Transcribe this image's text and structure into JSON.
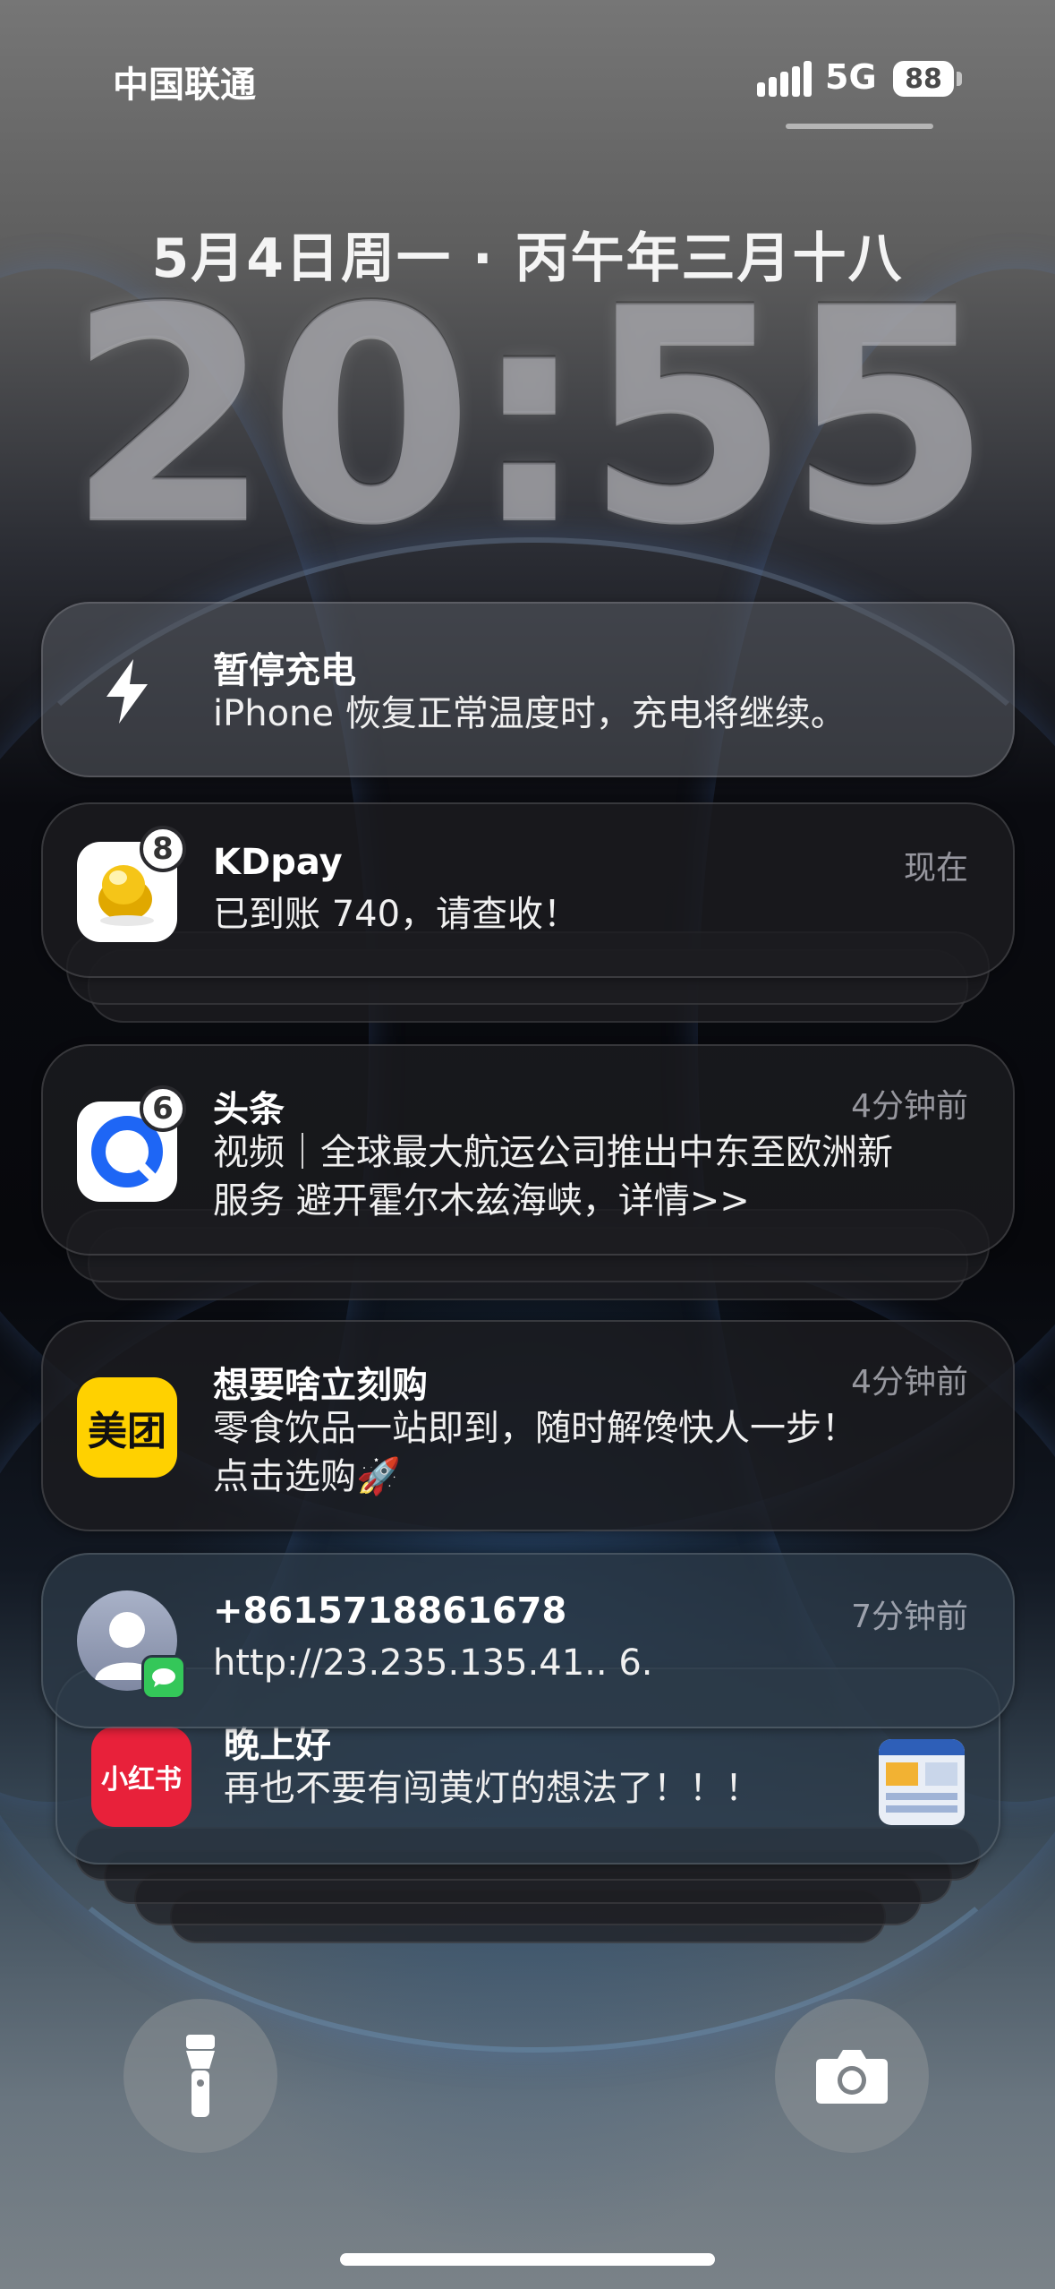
{
  "status_bar": {
    "carrier": "中国联通",
    "network": "5G",
    "battery": "88"
  },
  "lock_screen": {
    "date": "5月4日周一 · 丙午年三月十八",
    "time": "20:55"
  },
  "notifications": [
    {
      "app": "charging",
      "icon": "lightning-icon",
      "title": "暂停充电",
      "body": "iPhone 恢复正常温度时，充电将继续。"
    },
    {
      "app": "KDpay",
      "icon": "golden-bean-icon",
      "badge": "8",
      "title": "KDpay",
      "body": "已到账 740，请查收！",
      "time": "现在"
    },
    {
      "app": "头条",
      "icon": "toutiao-icon",
      "badge": "6",
      "title": "头条",
      "body_line1": "视频｜全球最大航运公司推出中东至欧洲新",
      "body_line2": "服务 避开霍尔木兹海峡，详情>>",
      "time": "4分钟前"
    },
    {
      "app": "美团",
      "icon_label": "美团",
      "title": "想要啥立刻购",
      "body_line1": "零食饮品一站即到，随时解馋快人一步！",
      "body_line2": "点击选购🚀",
      "time": "4分钟前"
    },
    {
      "app": "Messages",
      "icon": "contact-avatar-icon",
      "title": "+8615718861678",
      "body": "http://23.235.135.41.. 6.",
      "time": "7分钟前"
    },
    {
      "app": "小红书",
      "icon_label": "小红书",
      "title": "晚上好",
      "body": "再也不要有闯黄灯的想法了！！！"
    }
  ],
  "bottom": {
    "flashlight_icon": "flashlight-icon",
    "camera_icon": "camera-icon"
  },
  "colors": {
    "meituan_yellow": "#FFD100",
    "xiaohongshu_red": "#E8213A",
    "toutiao_blue": "#1E66F5",
    "messages_green": "#34C759"
  }
}
